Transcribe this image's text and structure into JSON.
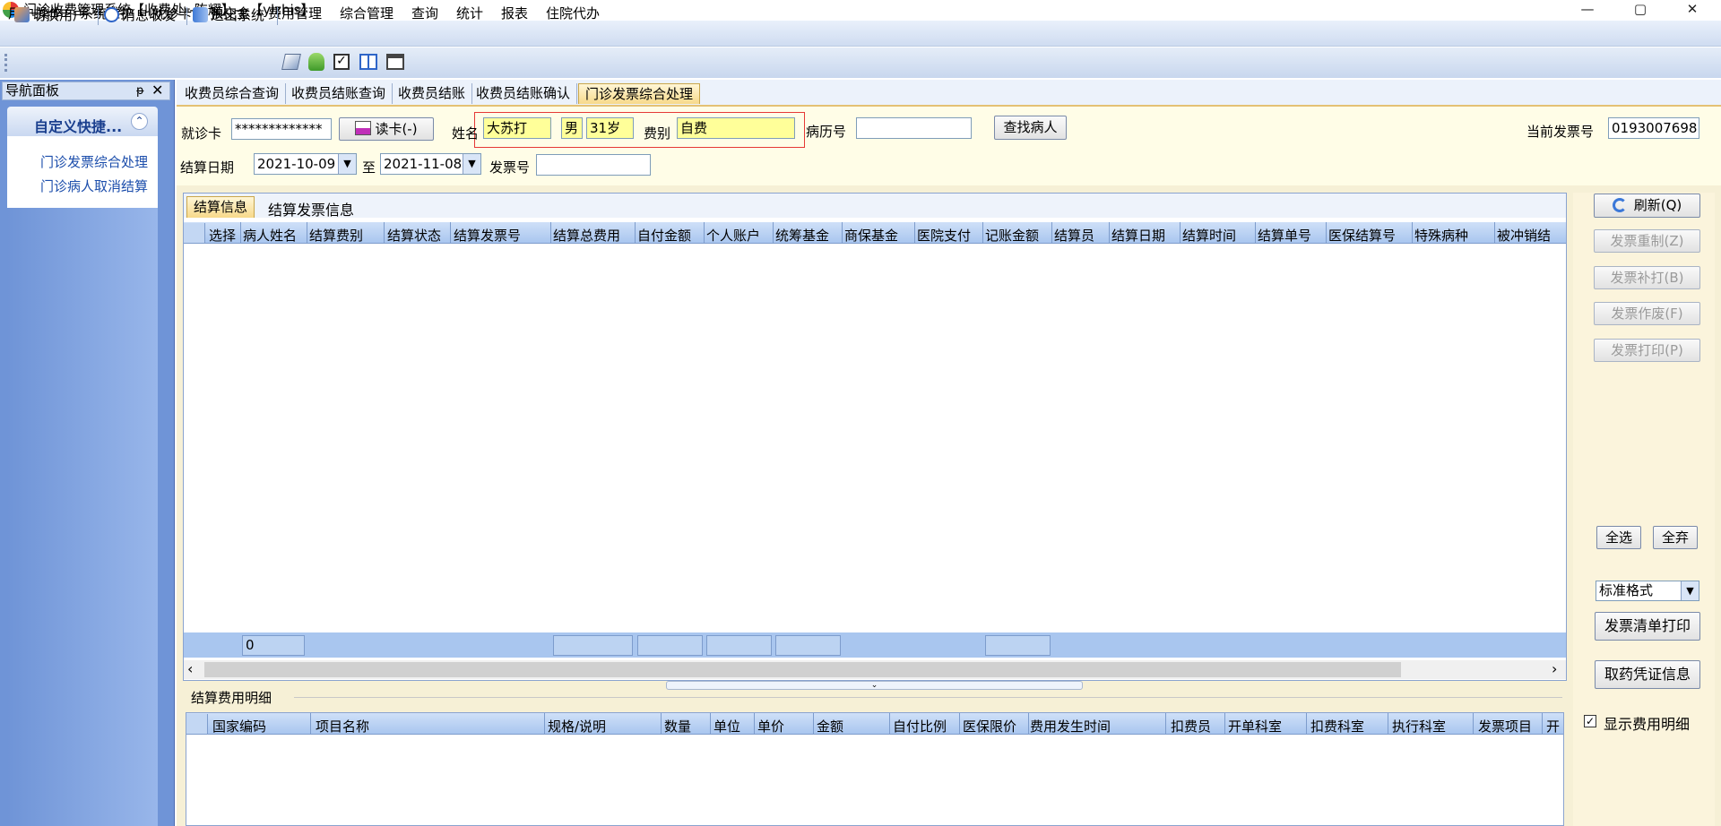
{
  "window": {
    "title": "门诊收费管理系统【收费处--陈耀】---【ylzhis】",
    "minimize": "—",
    "maximize": "▢",
    "close": "✕"
  },
  "menu": [
    "用户操作",
    "系统维护",
    "就诊卡",
    "预交金",
    "费用管理",
    "综合管理",
    "查询",
    "统计",
    "报表",
    "住院代办"
  ],
  "toolbar": {
    "switch_user": "切换用户",
    "messages": "消息收发",
    "exit": "退出系统"
  },
  "nav": {
    "title": "导航面板",
    "pin": "ᵽ",
    "close": "✕",
    "group_title": "自定义快捷...",
    "collapse": "⌃",
    "items": [
      "门诊发票综合处理",
      "门诊病人取消结算"
    ]
  },
  "tabs": [
    "收费员综合查询",
    "收费员结账查询",
    "收费员结账",
    "收费员结账确认",
    "门诊发票综合处理"
  ],
  "query": {
    "card_label": "就诊卡",
    "card_value": "*************",
    "read_card": "读卡(-)",
    "name_label": "姓名",
    "name_value": "大苏打",
    "gender": "男",
    "age": "31岁",
    "fee_type_label": "费别",
    "fee_type": "自费",
    "record_label": "病历号",
    "record_value": "",
    "find_patient": "查找病人",
    "current_invoice_label": "当前发票号",
    "current_invoice": "0193007698",
    "date_label": "结算日期",
    "date_from": "2021-10-09",
    "to_label": "至",
    "date_to": "2021-11-08",
    "invoice_label": "发票号",
    "invoice_value": ""
  },
  "grid1": {
    "tabs": [
      "结算信息",
      "结算发票信息"
    ],
    "columns": [
      "选择",
      "病人姓名",
      "结算费别",
      "结算状态",
      "结算发票号",
      "结算总费用",
      "自付金额",
      "个人账户",
      "统筹基金",
      "商保基金",
      "医院支付",
      "记账金额",
      "结算员",
      "结算日期",
      "结算时间",
      "结算单号",
      "医保结算号",
      "特殊病种",
      "被冲销结"
    ],
    "footer_count": "0",
    "scroll_left": "‹",
    "scroll_right": "›"
  },
  "splitter_icon": "⌄",
  "detail": {
    "title": "结算费用明细",
    "columns": [
      "国家编码",
      "项目名称",
      "规格/说明",
      "数量",
      "单位",
      "单价",
      "金额",
      "自付比例",
      "医保限价",
      "费用发生时间",
      "扣费员",
      "开单科室",
      "扣费科室",
      "执行科室",
      "发票项目",
      "开"
    ]
  },
  "actions": {
    "refresh": "刷新(Q)",
    "reissue": "发票重制(Z)",
    "reprint": "发票补打(B)",
    "void": "发票作废(F)",
    "print": "发票打印(P)",
    "select_all": "全选",
    "deselect_all": "全弃",
    "format": "标准格式",
    "print_list": "发票清单打印",
    "pickup_info": "取药凭证信息",
    "show_detail": "显示费用明细",
    "show_detail_checked": true
  },
  "colors": {
    "accent": "#6f94d7",
    "highlight": "#ffff99",
    "active_tab": "#f7d98a",
    "red_box": "#e53935"
  }
}
